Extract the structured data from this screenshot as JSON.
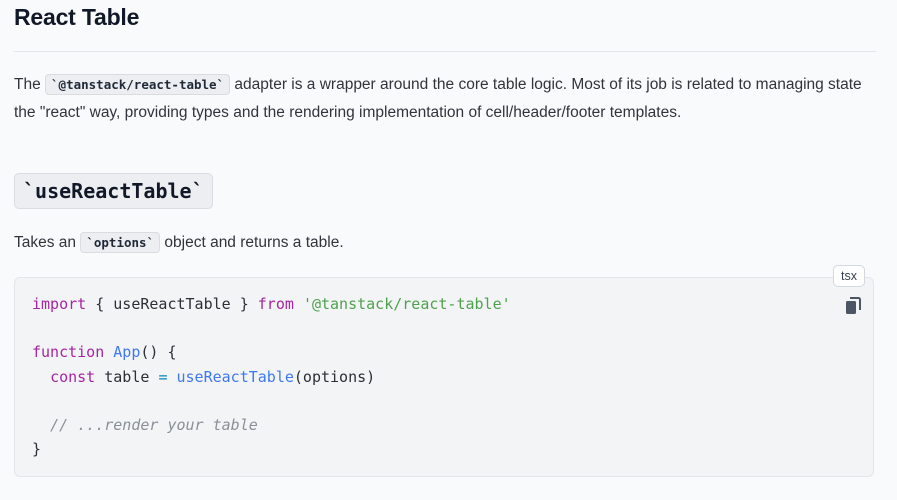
{
  "heading": "React Table",
  "intro": {
    "prefix": "The ",
    "code": "`@tanstack/react-table`",
    "suffix": " adapter is a wrapper around the core table logic. Most of its job is related to managing state the \"react\" way, providing types and the rendering implementation of cell/header/footer templates."
  },
  "section": {
    "title": "`useReactTable`",
    "desc_prefix": "Takes an ",
    "desc_code": "`options`",
    "desc_suffix": " object and returns a table."
  },
  "code_block": {
    "language": "tsx",
    "copy_icon": "copy-icon",
    "lines": {
      "l1_kw": "import",
      "l1_mid": " { useReactTable } ",
      "l1_from": "from",
      "l1_str": "'@tanstack/react-table'",
      "l3_kw": "function",
      "l3_fn": "App",
      "l3_rest": "() {",
      "l4_indent": "  ",
      "l4_kw": "const",
      "l4_var": " table ",
      "l4_op": "=",
      "l4_fn": "useReactTable",
      "l4_rest": "(options)",
      "l6_comment": "// ...render your table",
      "l7": "}"
    }
  }
}
